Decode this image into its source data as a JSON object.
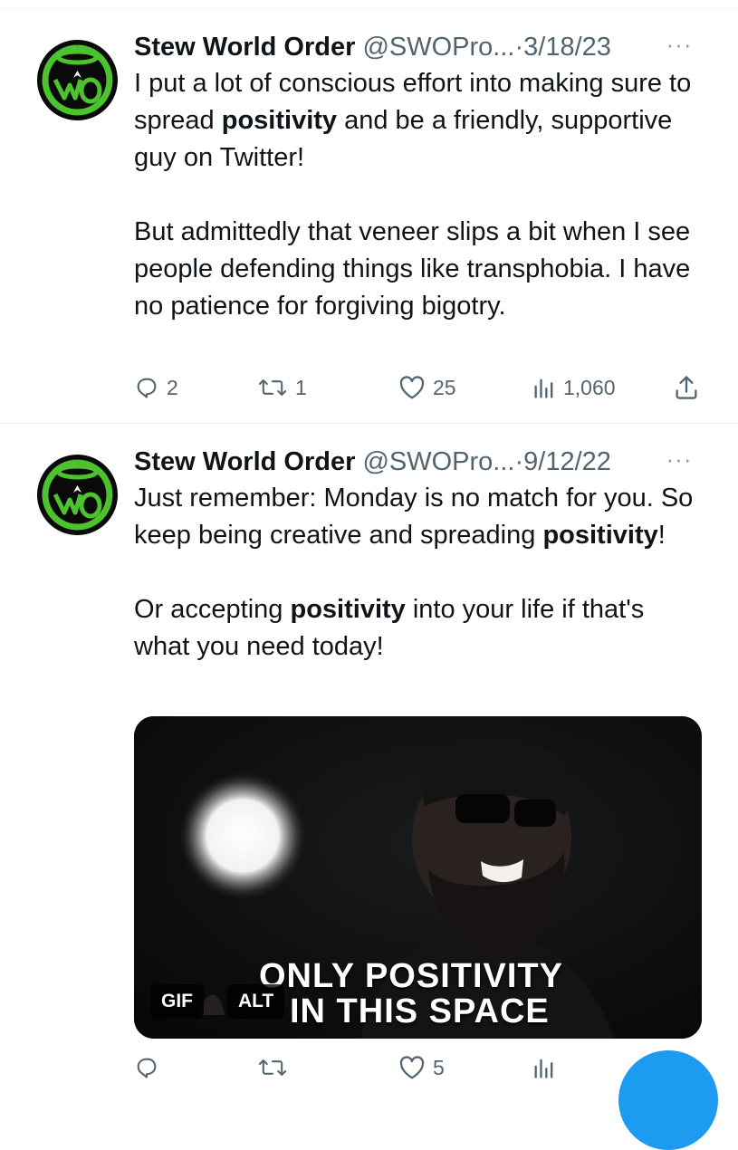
{
  "tweets": [
    {
      "name": "Stew World Order",
      "handle": "@SWOPro...",
      "separator": "·",
      "date": "3/18/23",
      "more": "···",
      "paragraphs": [
        [
          {
            "t": "I put a lot of conscious effort into making sure to spread ",
            "b": false
          },
          {
            "t": "positivity",
            "b": true
          },
          {
            "t": " and be a friendly, supportive guy on Twitter!",
            "b": false
          }
        ],
        [
          {
            "t": "But admittedly that veneer slips a bit when I see people defending things like transphobia. I have no patience for forgiving bigotry.",
            "b": false
          }
        ]
      ],
      "stats": {
        "replies": "2",
        "retweets": "1",
        "likes": "25",
        "views": "1,060"
      }
    },
    {
      "name": "Stew World Order",
      "handle": "@SWOPro...",
      "separator": "·",
      "date": "9/12/22",
      "more": "···",
      "paragraphs": [
        [
          {
            "t": "Just remember: Monday is no match for you. So keep being creative and spreading ",
            "b": false
          },
          {
            "t": "positivity",
            "b": true
          },
          {
            "t": "!",
            "b": false
          }
        ],
        [
          {
            "t": "Or accepting ",
            "b": false
          },
          {
            "t": "positivity",
            "b": true
          },
          {
            "t": " into your life if that's what you need today!",
            "b": false
          }
        ]
      ],
      "media": {
        "caption_line1": "ONLY POSITIVITY",
        "caption_line2": "IN THIS SPACE",
        "gif_badge": "GIF",
        "alt_badge": "ALT"
      },
      "stats": {
        "replies": "",
        "retweets": "",
        "likes": "5",
        "views": ""
      }
    }
  ],
  "icons": {
    "avatar": "swo-logo-avatar",
    "reply": "reply-icon",
    "retweet": "retweet-icon",
    "like": "heart-icon",
    "views": "views-icon",
    "share": "share-icon",
    "compose": "compose-fab"
  },
  "colors": {
    "text": "#0f1419",
    "secondary": "#536471",
    "accent": "#1d9bf0",
    "logo_green": "#4cc22f"
  }
}
